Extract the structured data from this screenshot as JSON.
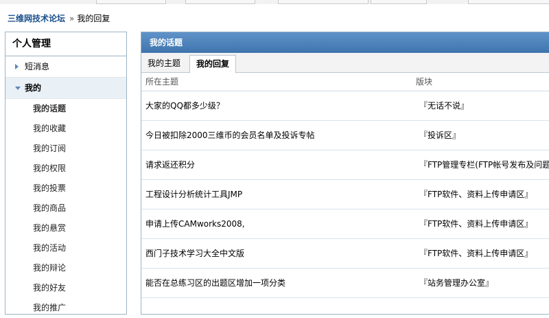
{
  "breadcrumb": {
    "site": "三维网技术论坛",
    "separator": "»",
    "current": "我的回复"
  },
  "sidebar": {
    "title": "个人管理",
    "sections": [
      {
        "label": "短消息",
        "expanded": false
      },
      {
        "label": "我的",
        "expanded": true
      }
    ],
    "items": [
      {
        "label": "我的话题",
        "active": true
      },
      {
        "label": "我的收藏"
      },
      {
        "label": "我的订阅"
      },
      {
        "label": "我的权限"
      },
      {
        "label": "我的投票"
      },
      {
        "label": "我的商品"
      },
      {
        "label": "我的悬赏"
      },
      {
        "label": "我的活动"
      },
      {
        "label": "我的辩论"
      },
      {
        "label": "我的好友"
      },
      {
        "label": "我的推广"
      }
    ]
  },
  "main": {
    "header": "我的话题",
    "tabs": [
      {
        "label": "我的主题",
        "active": false
      },
      {
        "label": "我的回复",
        "active": true
      }
    ],
    "columns": {
      "topic": "所在主题",
      "forum": "版块"
    },
    "rows": [
      {
        "topic": "大家的QQ都多少级？",
        "forum": "『无话不说』"
      },
      {
        "topic": "今日被扣除2000三维币的会员名单及投诉专帖",
        "forum": "『投诉区』"
      },
      {
        "topic": "请求返还积分",
        "forum": "『FTP管理专栏(FTP帐号发布及问题"
      },
      {
        "topic": "工程设计分析统计工具JMP",
        "forum": "『FTP软件、资料上传申请区』"
      },
      {
        "topic": "申请上传CAMworks2008,",
        "forum": "『FTP软件、资料上传申请区』"
      },
      {
        "topic": "西门子技术学习大全中文版",
        "forum": "『FTP软件、资料上传申请区』"
      },
      {
        "topic": "能否在总练习区的出题区增加一项分类",
        "forum": "『站务管理办公室』"
      }
    ]
  },
  "colors": {
    "accent": "#3f74ad",
    "link": "#1a4f8c",
    "border": "#9db3c5"
  }
}
